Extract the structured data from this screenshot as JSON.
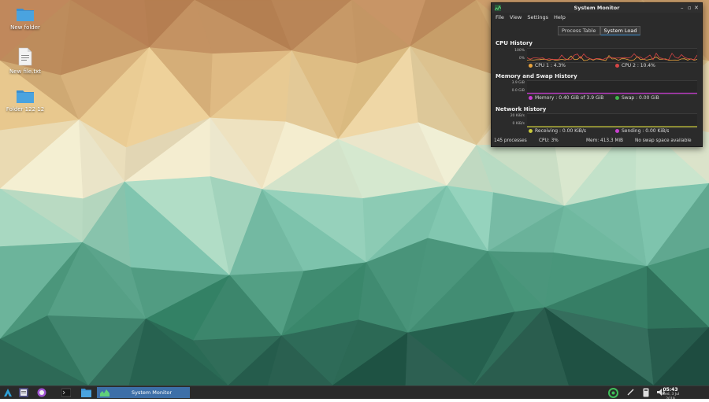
{
  "desktop": {
    "icons": [
      {
        "label": "New folder",
        "icon": "folder-icon"
      },
      {
        "label": "New file.txt",
        "icon": "text-file-icon"
      },
      {
        "label": "Folder 122 12",
        "icon": "folder-icon"
      }
    ]
  },
  "window": {
    "title": "System Monitor",
    "controls": [
      "minimize",
      "maximize",
      "close"
    ],
    "menu": [
      "File",
      "View",
      "Settings",
      "Help"
    ],
    "tabs": [
      {
        "label": "Process Table",
        "active": false
      },
      {
        "label": "System Load",
        "active": true
      }
    ],
    "cpu": {
      "title": "CPU History",
      "axis_top": "100%",
      "axis_bottom": "0%",
      "legend": [
        {
          "label": "CPU 1 : 4.3%",
          "color": "#e8a33d"
        },
        {
          "label": "CPU 2 : 10.4%",
          "color": "#d64545"
        }
      ]
    },
    "memory": {
      "title": "Memory and Swap History",
      "axis_top": "3.9 GiB",
      "axis_bottom": "0.0 GiB",
      "legend": [
        {
          "label": "Memory : 0.40 GiB of 3.9 GiB",
          "color": "#c83fd0"
        },
        {
          "label": "Swap : 0.00 GiB",
          "color": "#3fb54a"
        }
      ]
    },
    "network": {
      "title": "Network History",
      "axis_top": "20 KiB/s",
      "axis_bottom": "0 KiB/s",
      "legend": [
        {
          "label": "Receiving : 0.00 KiB/s",
          "color": "#c8c83a"
        },
        {
          "label": "Sending : 0.00 KiB/s",
          "color": "#c83fd0"
        }
      ]
    },
    "status": {
      "processes": "145 processes",
      "cpu": "CPU: 3%",
      "mem": "Mem: 413.3 MiB",
      "swap": "No swap space available"
    }
  },
  "taskbar": {
    "task_label": "System Monitor",
    "clock_time": "05:43",
    "clock_date": "Wed, 3 Jul 2019"
  },
  "colors": {
    "accent": "#3d8fd0",
    "taskbar_active": "#3d6fa8",
    "folder": "#4aa3df"
  }
}
